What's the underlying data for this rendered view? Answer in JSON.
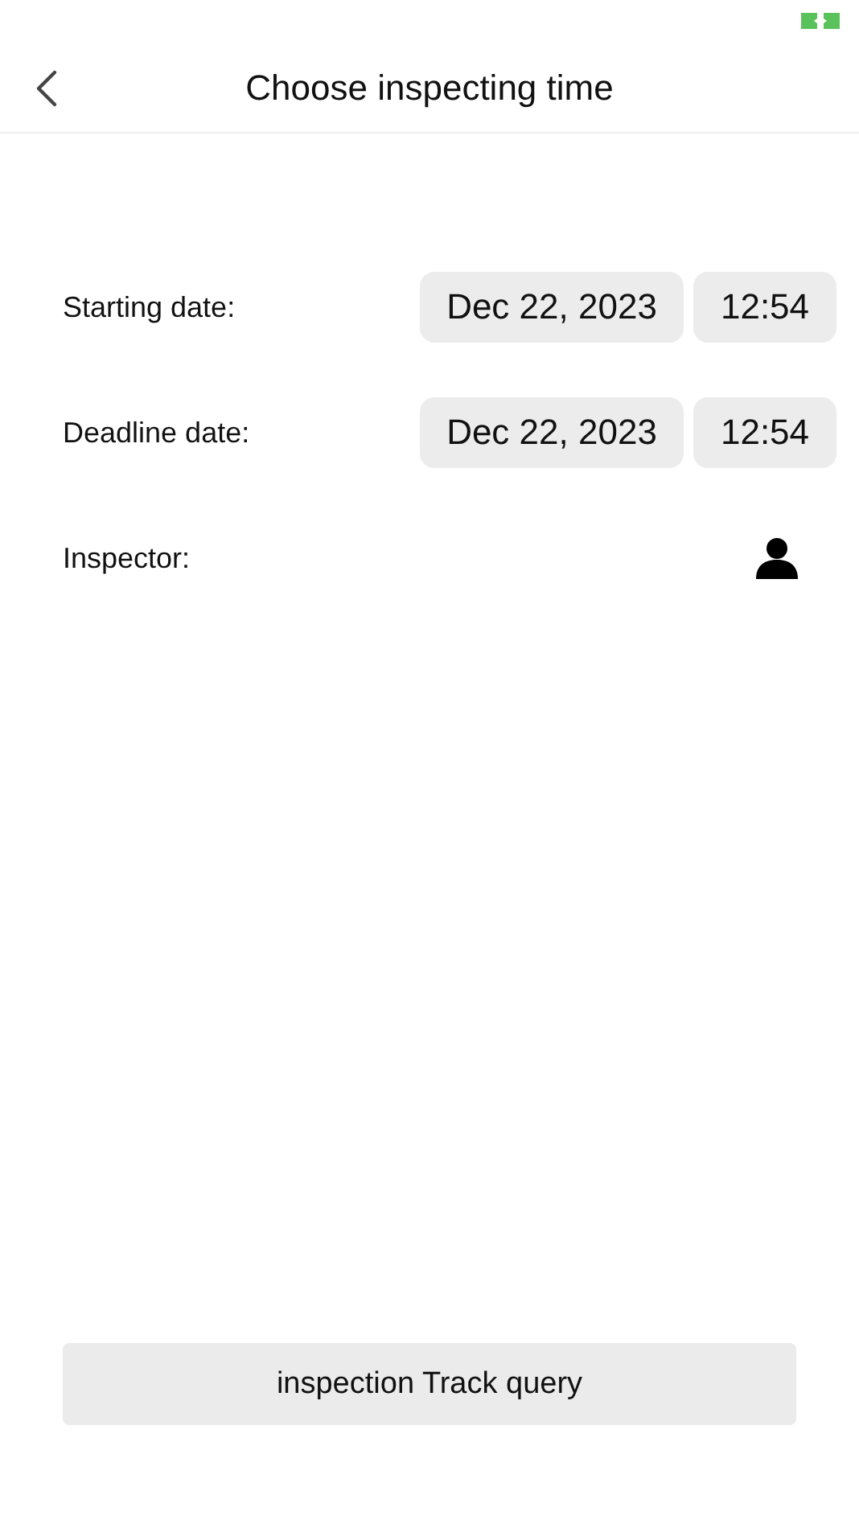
{
  "header": {
    "title": "Choose inspecting time"
  },
  "rows": [
    {
      "kind": "datetime",
      "label": "Starting date:",
      "date": "Dec 22, 2023",
      "time": "12:54"
    },
    {
      "kind": "datetime",
      "label": "Deadline date:",
      "date": "Dec 22, 2023",
      "time": "12:54"
    },
    {
      "kind": "person",
      "label": "Inspector:"
    }
  ],
  "query_button": "inspection Track query"
}
